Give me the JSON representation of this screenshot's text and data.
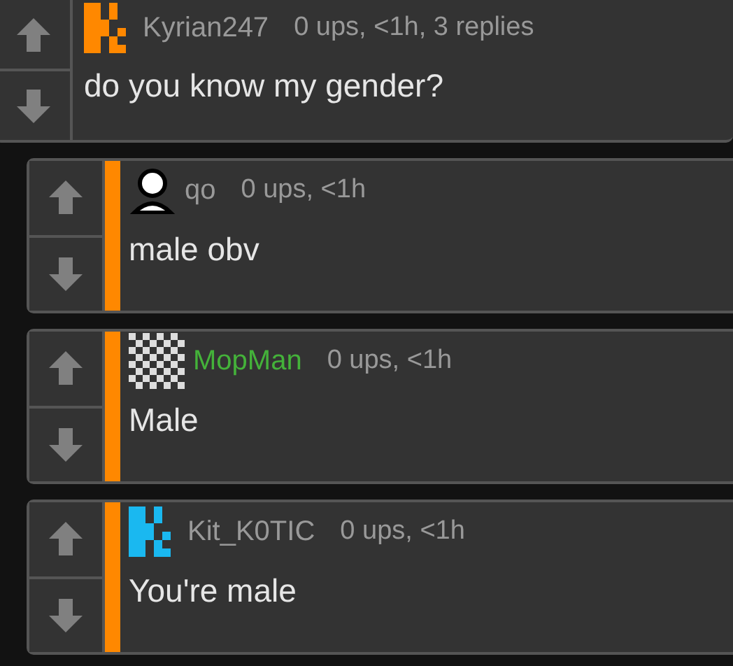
{
  "comment": {
    "author": {
      "name": "Kyrian247",
      "color": "#999999",
      "avatar": {
        "kind": "pixel-k",
        "color": "#ff8800"
      }
    },
    "meta": "0 ups, <1h, 3 replies",
    "text": "do you know my gender?"
  },
  "replies": [
    {
      "author": {
        "name": "qo",
        "color": "#999999",
        "avatar": {
          "kind": "person",
          "color": "#ffffff"
        }
      },
      "meta": "0 ups, <1h",
      "text": "male obv"
    },
    {
      "author": {
        "name": "MopMan",
        "color": "#44b23a",
        "avatar": {
          "kind": "checker",
          "color": "#dddddd"
        }
      },
      "meta": "0 ups, <1h",
      "text": "Male"
    },
    {
      "author": {
        "name": "Kit_K0TIC",
        "color": "#999999",
        "avatar": {
          "kind": "pixel-k",
          "color": "#1ab8f0"
        }
      },
      "meta": "0 ups, <1h",
      "text": "You're male"
    }
  ]
}
